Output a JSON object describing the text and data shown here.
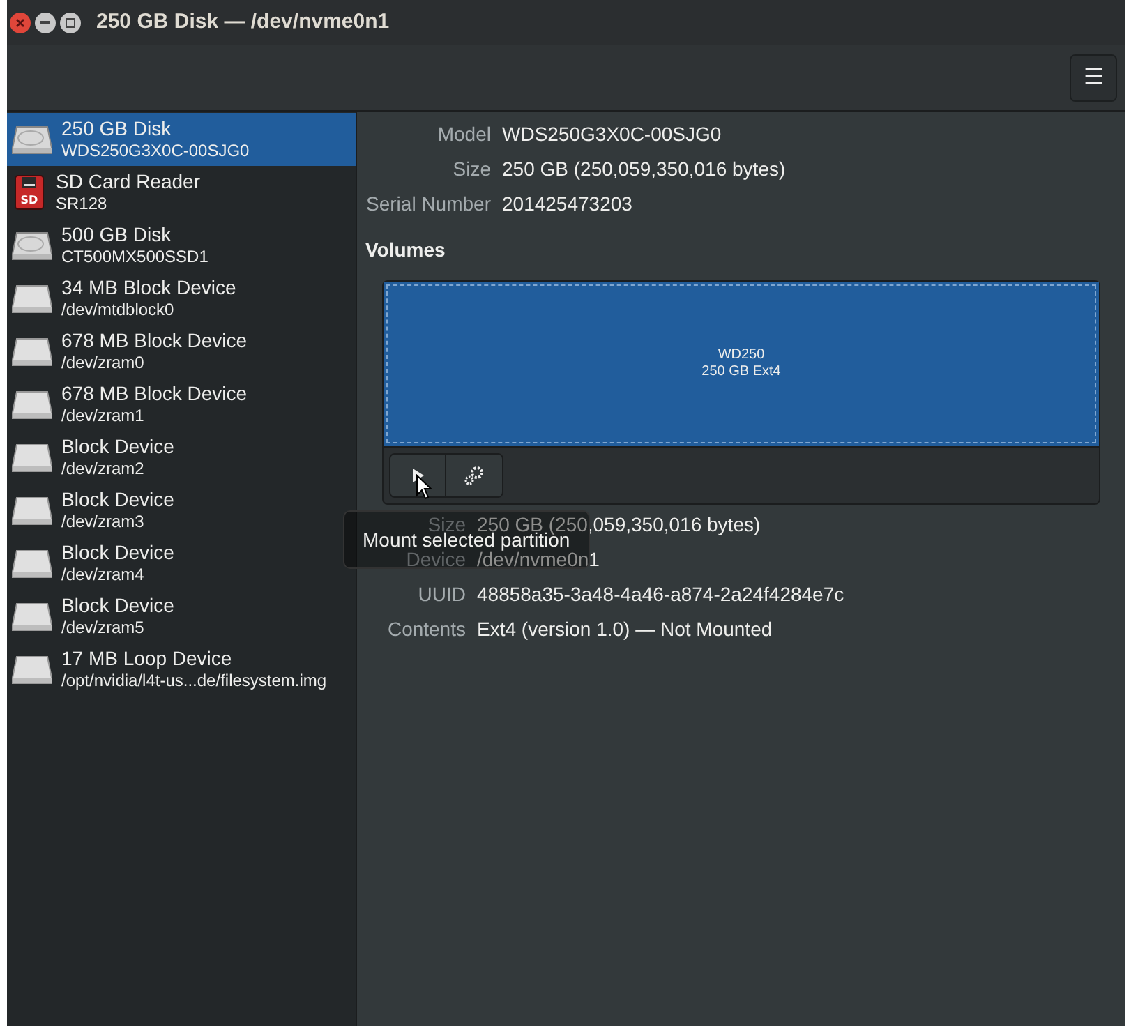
{
  "window": {
    "title": "250 GB Disk — /dev/nvme0n1"
  },
  "toolbar": {
    "menu_icon": "☰"
  },
  "sidebar": {
    "items": [
      {
        "kind": "disk",
        "title": "250 GB Disk",
        "subtitle": "WDS250G3X0C-00SJG0",
        "selected": true
      },
      {
        "kind": "sdcard",
        "title": "SD Card Reader",
        "subtitle": "SR128",
        "selected": false,
        "badge": "SD"
      },
      {
        "kind": "disk",
        "title": "500 GB Disk",
        "subtitle": "CT500MX500SSD1",
        "selected": false
      },
      {
        "kind": "block",
        "title": "34 MB Block Device",
        "subtitle": "/dev/mtdblock0",
        "selected": false
      },
      {
        "kind": "block",
        "title": "678 MB Block Device",
        "subtitle": "/dev/zram0",
        "selected": false
      },
      {
        "kind": "block",
        "title": "678 MB Block Device",
        "subtitle": "/dev/zram1",
        "selected": false
      },
      {
        "kind": "block",
        "title": "Block Device",
        "subtitle": "/dev/zram2",
        "selected": false
      },
      {
        "kind": "block",
        "title": "Block Device",
        "subtitle": "/dev/zram3",
        "selected": false
      },
      {
        "kind": "block",
        "title": "Block Device",
        "subtitle": "/dev/zram4",
        "selected": false
      },
      {
        "kind": "block",
        "title": "Block Device",
        "subtitle": "/dev/zram5",
        "selected": false
      },
      {
        "kind": "block",
        "title": "17 MB Loop Device",
        "subtitle": "/opt/nvidia/l4t-us...de/filesystem.img",
        "selected": false
      }
    ]
  },
  "drive_properties": [
    {
      "label": "Model",
      "value": "WDS250G3X0C-00SJG0"
    },
    {
      "label": "Size",
      "value": "250 GB (250,059,350,016 bytes)"
    },
    {
      "label": "Serial Number",
      "value": "201425473203"
    }
  ],
  "volumes": {
    "heading": "Volumes",
    "partitions": [
      {
        "name": "WD250",
        "description": "250 GB Ext4",
        "selected": true
      }
    ],
    "tooltip": "Mount selected partition"
  },
  "volume_properties": [
    {
      "label": "Size",
      "value": "250 GB (250,059,350,016 bytes)"
    },
    {
      "label": "Device",
      "value": "/dev/nvme0n1"
    },
    {
      "label": "UUID",
      "value": "48858a35-3a48-4a46-a874-2a24f4284e7c"
    },
    {
      "label": "Contents",
      "value": "Ext4 (version 1.0) — Not Mounted"
    }
  ]
}
